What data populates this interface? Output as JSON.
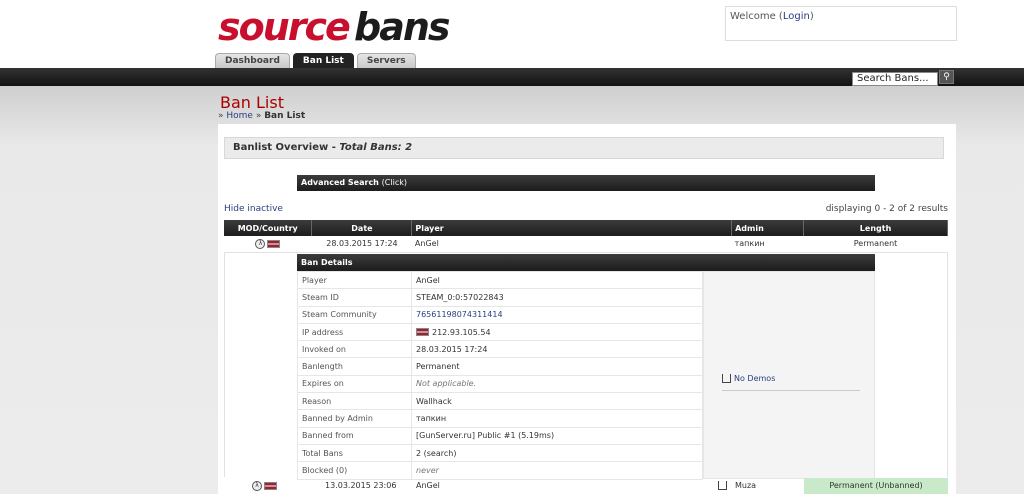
{
  "header": {
    "welcome_prefix": "Welcome (",
    "login_link": "Login",
    "welcome_suffix": ")",
    "tabs": [
      {
        "label": "Dashboard"
      },
      {
        "label": "Ban List"
      },
      {
        "label": "Servers"
      }
    ],
    "search_value": "Search Bans...",
    "brand_colors": {
      "red": "#c8102e",
      "dark": "#1c1c1c"
    }
  },
  "page": {
    "title": "Ban List",
    "breadcrumb_home": "Home",
    "breadcrumb_current": "Ban List",
    "overview_label": "Banlist Overview - ",
    "overview_total": "Total Bans: 2",
    "advanced_search": "Advanced Search",
    "advanced_search_click": "(Click)",
    "hide_inactive": "Hide inactive",
    "displaying": "displaying 0 - 2 of 2 results"
  },
  "table": {
    "columns": [
      "MOD/Country",
      "Date",
      "Player",
      "Admin",
      "Length"
    ],
    "rows": [
      {
        "date": "28.03.2015 17:24",
        "player": "AnGel",
        "admin": "тапкин",
        "length": "Permanent"
      },
      {
        "date": "13.03.2015 23:06",
        "player": "AnGel",
        "admin": "Muza",
        "length": "Permanent (Unbanned)"
      }
    ]
  },
  "details": {
    "title": "Ban Details",
    "rows": [
      {
        "key": "Player",
        "value": "AnGel"
      },
      {
        "key": "Steam ID",
        "value": "STEAM_0:0:57022843"
      },
      {
        "key": "Steam Community",
        "value": "76561198074311414"
      },
      {
        "key": "IP address",
        "value": "212.93.105.54"
      },
      {
        "key": "Invoked on",
        "value": "28.03.2015 17:24"
      },
      {
        "key": "Banlength",
        "value": "Permanent"
      },
      {
        "key": "Expires on",
        "value": "Not applicable."
      },
      {
        "key": "Reason",
        "value": "Wallhack"
      },
      {
        "key": "Banned by Admin",
        "value": "тапкин"
      },
      {
        "key": "Banned from",
        "value": "[GunServer.ru] Public #1 (5.19ms)"
      },
      {
        "key": "Total Bans",
        "value": "2 (search)"
      },
      {
        "key": "Blocked (0)",
        "value": "never"
      }
    ],
    "demos": "No Demos"
  }
}
